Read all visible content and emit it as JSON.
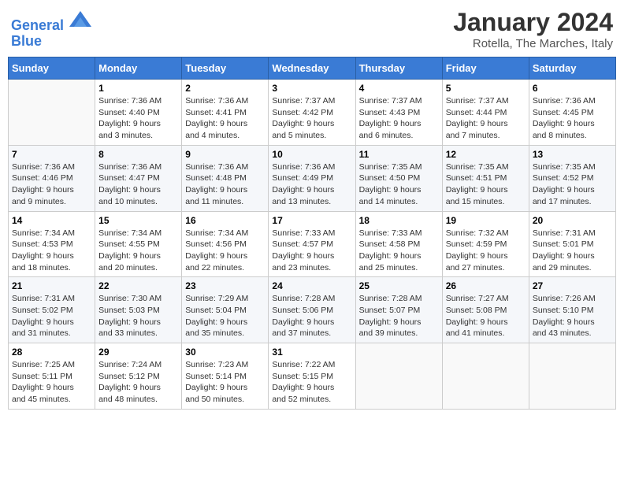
{
  "header": {
    "logo_line1": "General",
    "logo_line2": "Blue",
    "title": "January 2024",
    "subtitle": "Rotella, The Marches, Italy"
  },
  "days_of_week": [
    "Sunday",
    "Monday",
    "Tuesday",
    "Wednesday",
    "Thursday",
    "Friday",
    "Saturday"
  ],
  "weeks": [
    [
      {
        "day": "",
        "info": ""
      },
      {
        "day": "1",
        "info": "Sunrise: 7:36 AM\nSunset: 4:40 PM\nDaylight: 9 hours\nand 3 minutes."
      },
      {
        "day": "2",
        "info": "Sunrise: 7:36 AM\nSunset: 4:41 PM\nDaylight: 9 hours\nand 4 minutes."
      },
      {
        "day": "3",
        "info": "Sunrise: 7:37 AM\nSunset: 4:42 PM\nDaylight: 9 hours\nand 5 minutes."
      },
      {
        "day": "4",
        "info": "Sunrise: 7:37 AM\nSunset: 4:43 PM\nDaylight: 9 hours\nand 6 minutes."
      },
      {
        "day": "5",
        "info": "Sunrise: 7:37 AM\nSunset: 4:44 PM\nDaylight: 9 hours\nand 7 minutes."
      },
      {
        "day": "6",
        "info": "Sunrise: 7:36 AM\nSunset: 4:45 PM\nDaylight: 9 hours\nand 8 minutes."
      }
    ],
    [
      {
        "day": "7",
        "info": "Sunrise: 7:36 AM\nSunset: 4:46 PM\nDaylight: 9 hours\nand 9 minutes."
      },
      {
        "day": "8",
        "info": "Sunrise: 7:36 AM\nSunset: 4:47 PM\nDaylight: 9 hours\nand 10 minutes."
      },
      {
        "day": "9",
        "info": "Sunrise: 7:36 AM\nSunset: 4:48 PM\nDaylight: 9 hours\nand 11 minutes."
      },
      {
        "day": "10",
        "info": "Sunrise: 7:36 AM\nSunset: 4:49 PM\nDaylight: 9 hours\nand 13 minutes."
      },
      {
        "day": "11",
        "info": "Sunrise: 7:35 AM\nSunset: 4:50 PM\nDaylight: 9 hours\nand 14 minutes."
      },
      {
        "day": "12",
        "info": "Sunrise: 7:35 AM\nSunset: 4:51 PM\nDaylight: 9 hours\nand 15 minutes."
      },
      {
        "day": "13",
        "info": "Sunrise: 7:35 AM\nSunset: 4:52 PM\nDaylight: 9 hours\nand 17 minutes."
      }
    ],
    [
      {
        "day": "14",
        "info": "Sunrise: 7:34 AM\nSunset: 4:53 PM\nDaylight: 9 hours\nand 18 minutes."
      },
      {
        "day": "15",
        "info": "Sunrise: 7:34 AM\nSunset: 4:55 PM\nDaylight: 9 hours\nand 20 minutes."
      },
      {
        "day": "16",
        "info": "Sunrise: 7:34 AM\nSunset: 4:56 PM\nDaylight: 9 hours\nand 22 minutes."
      },
      {
        "day": "17",
        "info": "Sunrise: 7:33 AM\nSunset: 4:57 PM\nDaylight: 9 hours\nand 23 minutes."
      },
      {
        "day": "18",
        "info": "Sunrise: 7:33 AM\nSunset: 4:58 PM\nDaylight: 9 hours\nand 25 minutes."
      },
      {
        "day": "19",
        "info": "Sunrise: 7:32 AM\nSunset: 4:59 PM\nDaylight: 9 hours\nand 27 minutes."
      },
      {
        "day": "20",
        "info": "Sunrise: 7:31 AM\nSunset: 5:01 PM\nDaylight: 9 hours\nand 29 minutes."
      }
    ],
    [
      {
        "day": "21",
        "info": "Sunrise: 7:31 AM\nSunset: 5:02 PM\nDaylight: 9 hours\nand 31 minutes."
      },
      {
        "day": "22",
        "info": "Sunrise: 7:30 AM\nSunset: 5:03 PM\nDaylight: 9 hours\nand 33 minutes."
      },
      {
        "day": "23",
        "info": "Sunrise: 7:29 AM\nSunset: 5:04 PM\nDaylight: 9 hours\nand 35 minutes."
      },
      {
        "day": "24",
        "info": "Sunrise: 7:28 AM\nSunset: 5:06 PM\nDaylight: 9 hours\nand 37 minutes."
      },
      {
        "day": "25",
        "info": "Sunrise: 7:28 AM\nSunset: 5:07 PM\nDaylight: 9 hours\nand 39 minutes."
      },
      {
        "day": "26",
        "info": "Sunrise: 7:27 AM\nSunset: 5:08 PM\nDaylight: 9 hours\nand 41 minutes."
      },
      {
        "day": "27",
        "info": "Sunrise: 7:26 AM\nSunset: 5:10 PM\nDaylight: 9 hours\nand 43 minutes."
      }
    ],
    [
      {
        "day": "28",
        "info": "Sunrise: 7:25 AM\nSunset: 5:11 PM\nDaylight: 9 hours\nand 45 minutes."
      },
      {
        "day": "29",
        "info": "Sunrise: 7:24 AM\nSunset: 5:12 PM\nDaylight: 9 hours\nand 48 minutes."
      },
      {
        "day": "30",
        "info": "Sunrise: 7:23 AM\nSunset: 5:14 PM\nDaylight: 9 hours\nand 50 minutes."
      },
      {
        "day": "31",
        "info": "Sunrise: 7:22 AM\nSunset: 5:15 PM\nDaylight: 9 hours\nand 52 minutes."
      },
      {
        "day": "",
        "info": ""
      },
      {
        "day": "",
        "info": ""
      },
      {
        "day": "",
        "info": ""
      }
    ]
  ]
}
